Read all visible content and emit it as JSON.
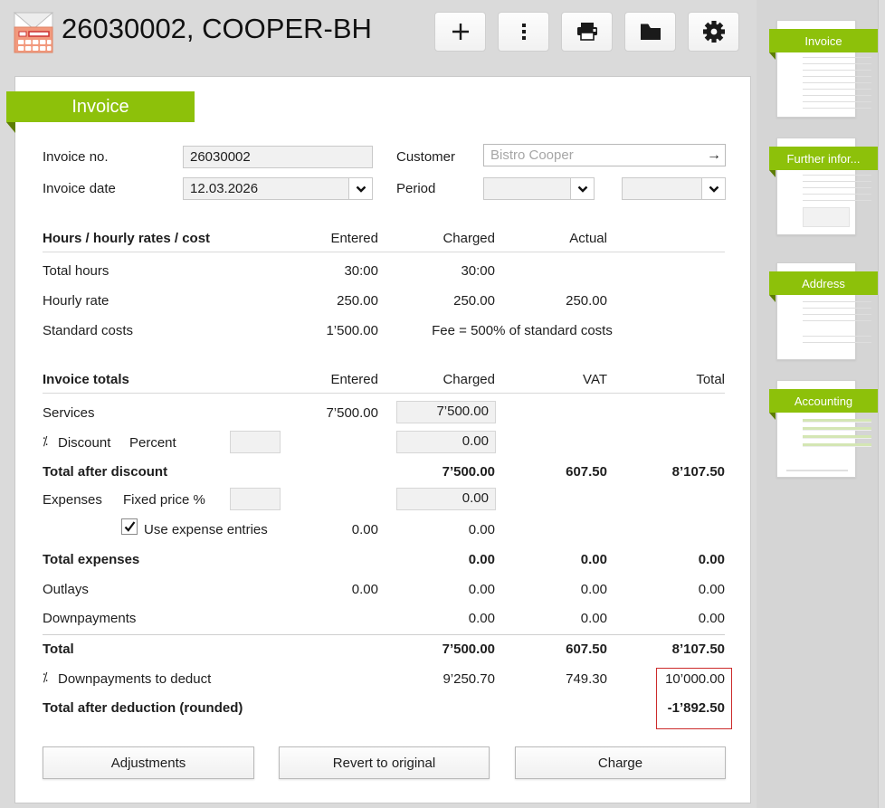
{
  "colors": {
    "accent": "#8dc10a",
    "accent_dark": "#5d7d05",
    "highlight_red": "#cc2b2b"
  },
  "header": {
    "title": "26030002, COOPER-BH"
  },
  "panel": {
    "tab": "Invoice"
  },
  "form": {
    "invoice_no_label": "Invoice no.",
    "invoice_no_value": "26030002",
    "invoice_date_label": "Invoice date",
    "invoice_date_value": "12.03.2026",
    "customer_label": "Customer",
    "customer_placeholder": "Bistro Cooper",
    "period_label": "Period"
  },
  "hours": {
    "title": "Hours / hourly rates / cost",
    "col_entered": "Entered",
    "col_charged": "Charged",
    "col_actual": "Actual",
    "total_hours": {
      "label": "Total hours",
      "entered": "30:00",
      "charged": "30:00"
    },
    "hourly_rate": {
      "label": "Hourly rate",
      "entered": "250.00",
      "charged": "250.00",
      "actual": "250.00"
    },
    "standard_costs": {
      "label": "Standard costs",
      "entered": "1’500.00",
      "note": "Fee = 500% of standard costs"
    }
  },
  "totals": {
    "title": "Invoice totals",
    "col_entered": "Entered",
    "col_charged": "Charged",
    "col_vat": "VAT",
    "col_total": "Total",
    "services": {
      "label": "Services",
      "entered": "7’500.00",
      "charged": "7’500.00"
    },
    "discount": {
      "prefix": "⁒",
      "label": "Discount",
      "sublabel": "Percent",
      "percent": "",
      "charged": "0.00"
    },
    "total_after_discount": {
      "label": "Total after discount",
      "charged": "7’500.00",
      "vat": "607.50",
      "total": "8’107.50"
    },
    "expenses": {
      "label": "Expenses",
      "sublabel": "Fixed price %",
      "percent": "",
      "charged": "0.00"
    },
    "use_expense": {
      "label": "Use expense entries",
      "entered": "0.00",
      "charged": "0.00"
    },
    "total_expenses": {
      "label": "Total expenses",
      "charged": "0.00",
      "vat": "0.00",
      "total": "0.00"
    },
    "outlays": {
      "label": "Outlays",
      "entered": "0.00",
      "charged": "0.00",
      "vat": "0.00",
      "total": "0.00"
    },
    "downpayments": {
      "label": "Downpayments",
      "charged": "0.00",
      "vat": "0.00",
      "total": "0.00"
    },
    "total": {
      "label": "Total",
      "charged": "7’500.00",
      "vat": "607.50",
      "total": "8’107.50"
    },
    "downpayments_deduct": {
      "prefix": "⁒",
      "label": "Downpayments to deduct",
      "charged": "9’250.70",
      "vat": "749.30",
      "total": "10’000.00"
    },
    "total_after_deduction": {
      "label": "Total after deduction (rounded)",
      "total": "-1’892.50"
    }
  },
  "actions": {
    "adjustments": "Adjustments",
    "revert": "Revert to original",
    "charge": "Charge"
  },
  "sidebar": {
    "items": [
      {
        "label": "Invoice"
      },
      {
        "label": "Further infor..."
      },
      {
        "label": "Address"
      },
      {
        "label": "Accounting"
      }
    ]
  }
}
